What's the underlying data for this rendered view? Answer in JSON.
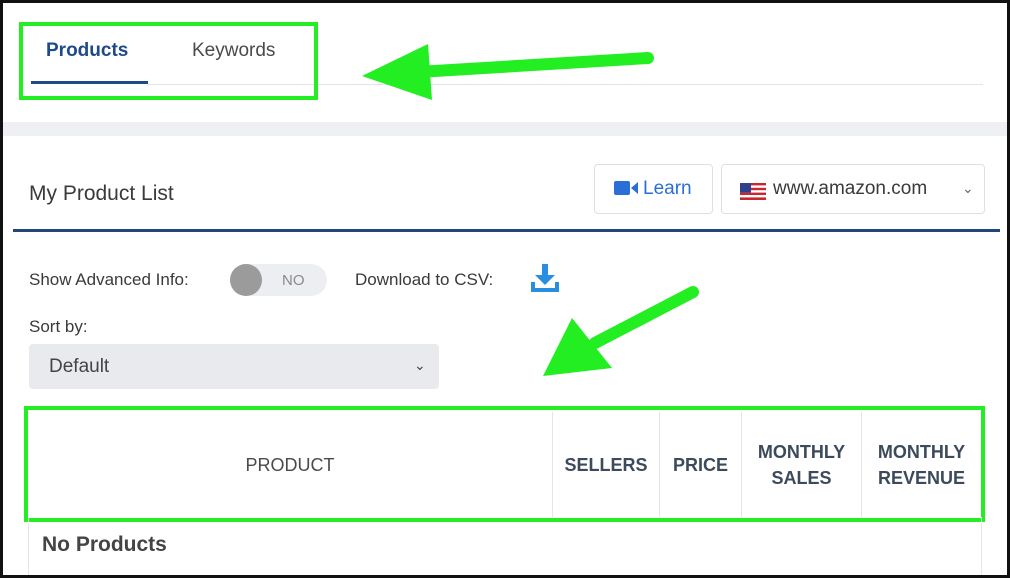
{
  "tabs": {
    "products": "Products",
    "keywords": "Keywords"
  },
  "product_list": {
    "title": "My Product List",
    "learn_label": "Learn",
    "marketplace_label": "www.amazon.com"
  },
  "controls": {
    "advanced_info_label": "Show Advanced Info:",
    "advanced_info_toggle": "NO",
    "download_csv_label": "Download to CSV:",
    "sort_label": "Sort by:",
    "sort_value": "Default"
  },
  "table": {
    "columns": [
      "PRODUCT",
      "SELLERS",
      "PRICE",
      "MONTHLY SALES",
      "MONTHLY REVENUE"
    ],
    "empty_text": "No Products"
  },
  "colors": {
    "accent": "#1f4a8a",
    "highlight": "#22ee22",
    "link_blue": "#2a6fd6"
  },
  "icons": {
    "learn": "video-camera-icon",
    "flag": "us-flag-icon",
    "csv": "download-icon"
  }
}
